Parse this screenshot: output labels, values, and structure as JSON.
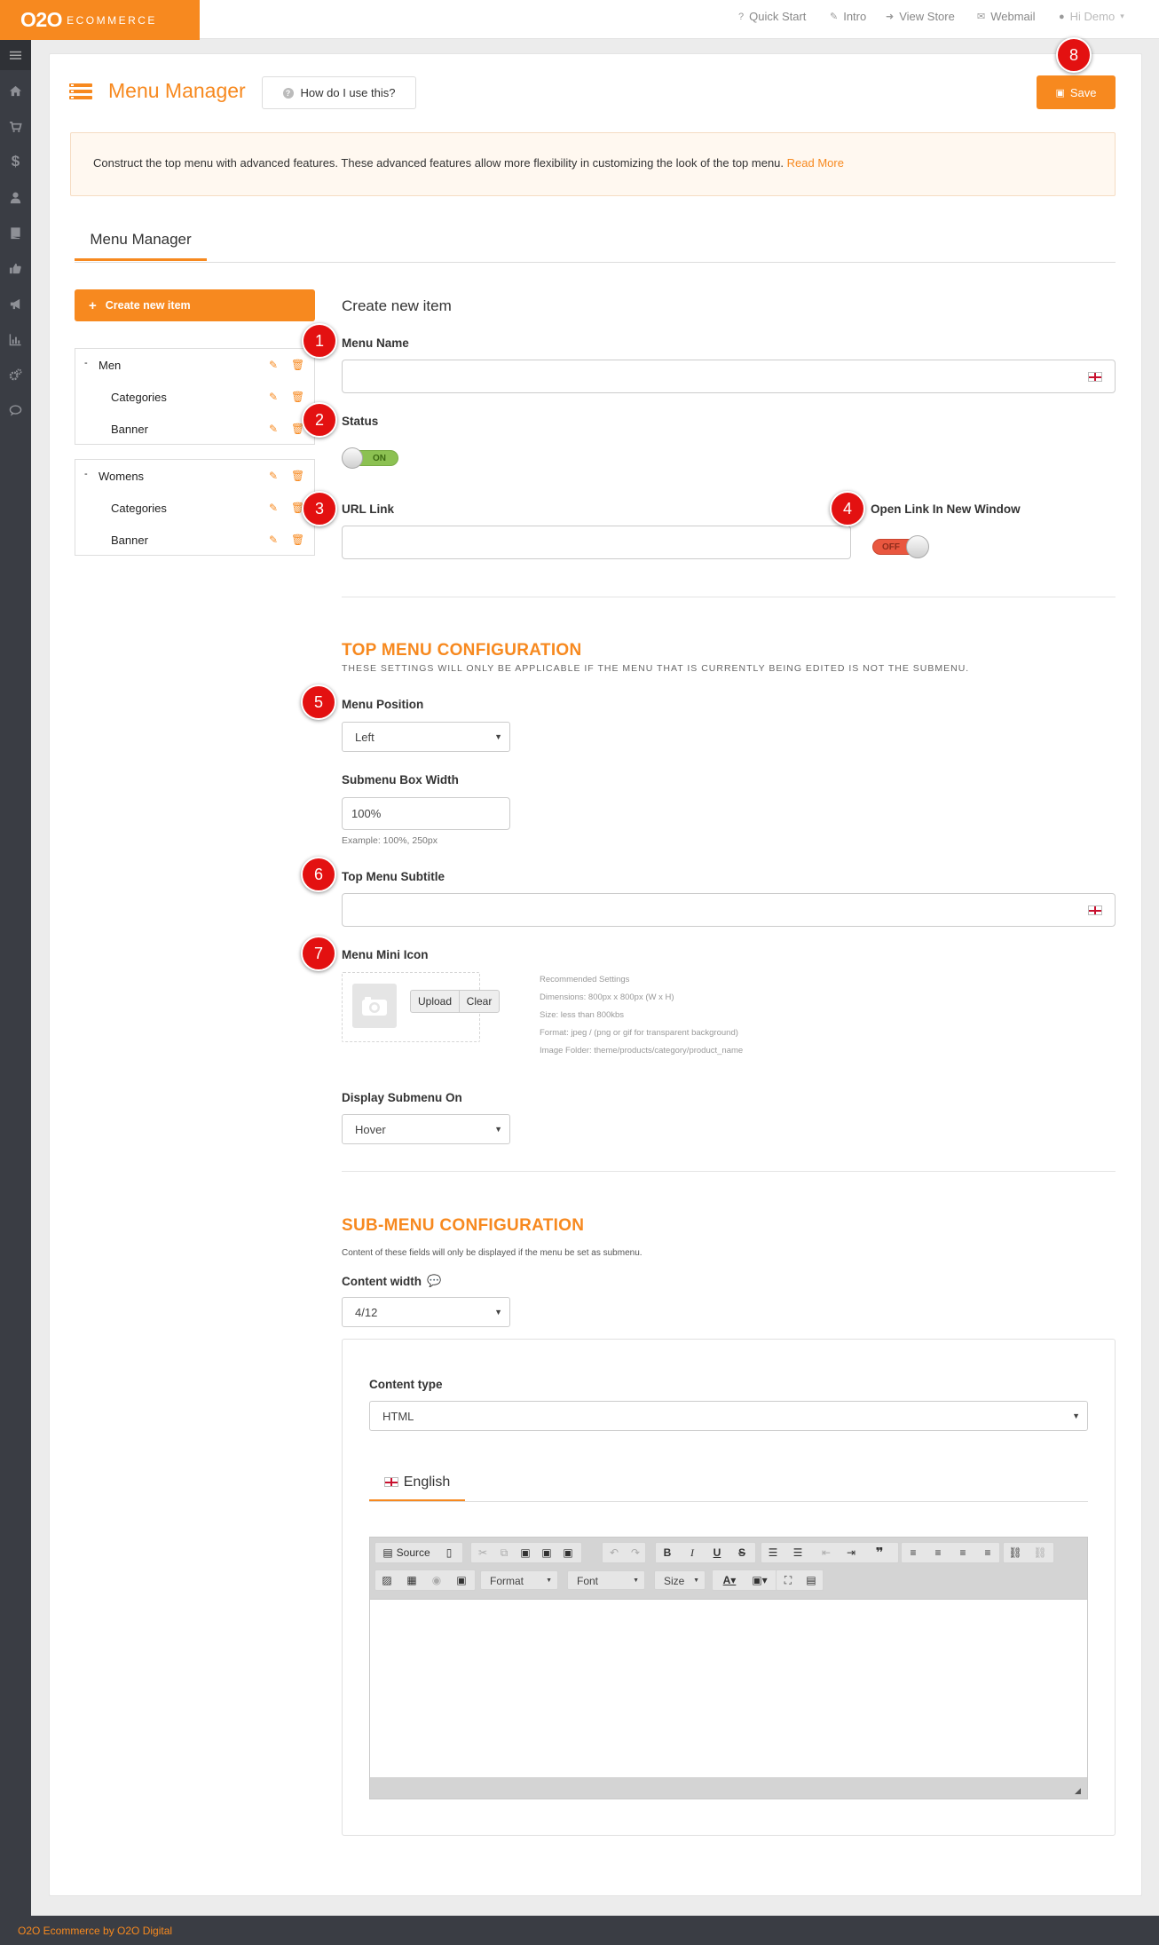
{
  "header": {
    "logo_main": "O2O",
    "logo_sub": "ECOMMERCE",
    "links": [
      {
        "label": "Quick Start",
        "icon": "question-icon"
      },
      {
        "label": "Intro",
        "icon": "magic-wand-icon"
      },
      {
        "label": "View Store",
        "icon": "sign-in-icon"
      },
      {
        "label": "Webmail",
        "icon": "envelope-icon"
      },
      {
        "label": "Hi Demo",
        "icon": "user-icon"
      }
    ]
  },
  "sidebar": {
    "icons": [
      "menu-icon",
      "home-icon",
      "cart-icon",
      "dollar-icon",
      "user-icon",
      "book-icon",
      "thumbs-up-icon",
      "megaphone-icon",
      "chart-icon",
      "cogs-icon",
      "comment-icon"
    ]
  },
  "page": {
    "title": "Menu Manager",
    "help_button": "How do I use this?",
    "save_button": "Save",
    "info_text": "Construct the top menu with advanced features. These advanced features allow more flexibility in customizing the look of the top menu.",
    "info_link": "Read More",
    "tab": "Menu Manager"
  },
  "tree": {
    "create_button": "Create new item",
    "groups": [
      {
        "name": "Men",
        "children": [
          "Categories",
          "Banner"
        ]
      },
      {
        "name": "Womens",
        "children": [
          "Categories",
          "Banner"
        ]
      }
    ]
  },
  "form": {
    "heading": "Create new item",
    "menu_name_label": "Menu Name",
    "status_label": "Status",
    "status_value": "ON",
    "url_label": "URL Link",
    "new_window_label": "Open Link In New Window",
    "new_window_value": "OFF"
  },
  "top_config": {
    "title": "TOP MENU CONFIGURATION",
    "subtitle": "THESE SETTINGS WILL ONLY BE APPLICABLE IF THE MENU THAT IS CURRENTLY BEING EDITED IS NOT THE SUBMENU.",
    "position_label": "Menu Position",
    "position_value": "Left",
    "width_label": "Submenu Box Width",
    "width_value": "100%",
    "width_hint": "Example: 100%, 250px",
    "subtitle_label": "Top Menu Subtitle",
    "icon_label": "Menu Mini Icon",
    "upload_button": "Upload",
    "clear_button": "Clear",
    "recommended_title": "Recommended Settings",
    "recommended": [
      "Dimensions: 800px x 800px (W x H)",
      "Size: less than 800kbs",
      "Format: jpeg / (png or gif for transparent background)",
      "Image Folder: theme/products/category/product_name"
    ],
    "display_label": "Display Submenu On",
    "display_value": "Hover"
  },
  "sub_config": {
    "title": "SUB-MENU CONFIGURATION",
    "subtitle": "Content of these fields will only be displayed if the menu be set as submenu.",
    "width_label": "Content width",
    "width_value": "4/12",
    "type_label": "Content type",
    "type_value": "HTML",
    "lang_tab": "English",
    "toolbar": {
      "source": "Source",
      "format": "Format",
      "font": "Font",
      "size": "Size"
    }
  },
  "badges": [
    "1",
    "2",
    "3",
    "4",
    "5",
    "6",
    "7",
    "8"
  ],
  "footer": {
    "text": "O2O Ecommerce by O2O Digital"
  },
  "colors": {
    "accent": "#f7891f",
    "sidebar": "#3a3d44",
    "badge": "#e31111",
    "on": "#8cc152",
    "off": "#e9573f"
  }
}
